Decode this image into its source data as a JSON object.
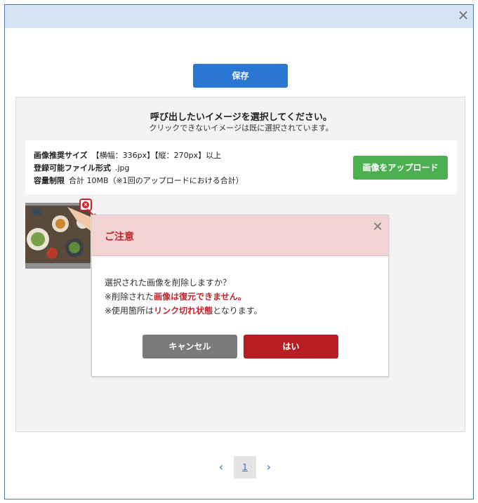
{
  "window": {
    "close_glyph": "✕"
  },
  "toolbar": {
    "save_label": "保存"
  },
  "panel": {
    "title": "呼び出したいイメージを選択してください。",
    "subtitle": "クリックできないイメージは既に選択されています。",
    "info": {
      "size_label": "画像推奨サイズ",
      "size_value": "【横幅：336px】【縦：270px】以上",
      "format_label": "登録可能ファイル形式",
      "format_value": ".jpg",
      "capacity_label": "容量制限",
      "capacity_value": "合計 10MB（※1回のアップロードにおける合計）"
    },
    "upload_label": "画像をアップロード"
  },
  "dialog": {
    "title": "ご注意",
    "close_glyph": "✕",
    "line1": "選択された画像を削除しますか？",
    "line2_pre": "※削除された",
    "line2_em": "画像は復元できません。",
    "line3_pre": "※使用箇所は",
    "line3_em": "リンク切れ状態",
    "line3_post": "となります。",
    "cancel_label": "キャンセル",
    "yes_label": "はい"
  },
  "pagination": {
    "prev": "‹",
    "current": "1",
    "next": "›"
  },
  "icons": {
    "delete": "delete-icon",
    "close": "close-icon",
    "arrow": "arrow-icon"
  },
  "colors": {
    "primary": "#2a76d2",
    "upload": "#4caf50",
    "danger": "#b81e22",
    "header": "#d6e4f5"
  }
}
